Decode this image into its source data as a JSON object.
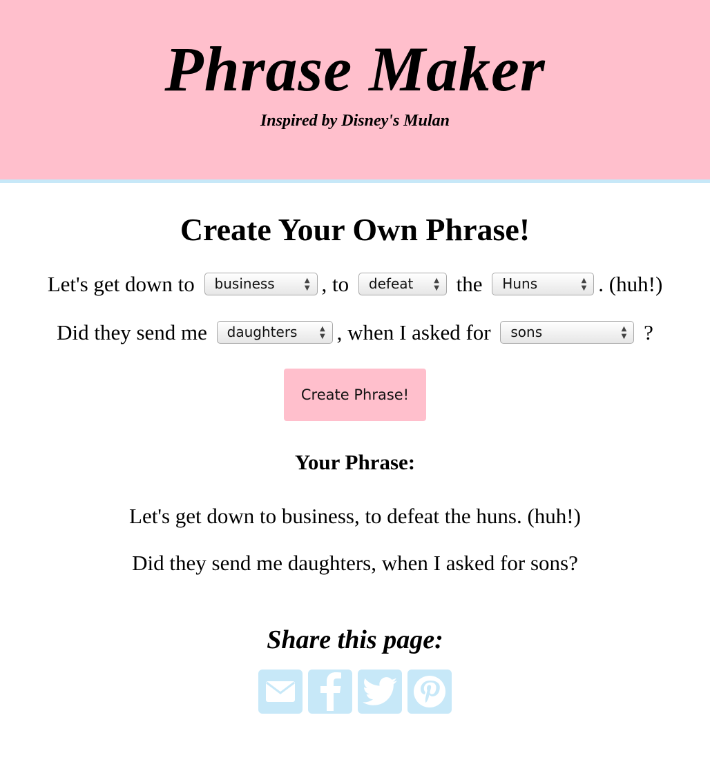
{
  "header": {
    "title": "Phrase Maker",
    "subtitle": "Inspired by Disney's Mulan"
  },
  "main": {
    "heading": "Create Your Own Phrase!",
    "line1": {
      "text_a": "Let's get down to",
      "select_1": "business",
      "text_b": ", to",
      "select_2": "defeat",
      "text_c": "the",
      "select_3": "Huns",
      "text_d": ". (huh!)"
    },
    "line2": {
      "text_a": "Did they send me",
      "select_1": "daughters",
      "text_b": ", when I asked for",
      "select_2": "sons",
      "text_c": "?"
    },
    "create_button": "Create Phrase!"
  },
  "result": {
    "heading": "Your Phrase:",
    "line1": "Let's get down to business, to defeat the huns. (huh!)",
    "line2": "Did they send me daughters, when I asked for sons?"
  },
  "share": {
    "heading": "Share this page:",
    "icons": [
      "email-icon",
      "facebook-icon",
      "twitter-icon",
      "pinterest-icon"
    ]
  },
  "colors": {
    "header_bg": "#ffbfcc",
    "header_border": "#c7e8f8",
    "button_bg": "#ffbfcc",
    "share_icon_bg": "#c7e8f8"
  }
}
